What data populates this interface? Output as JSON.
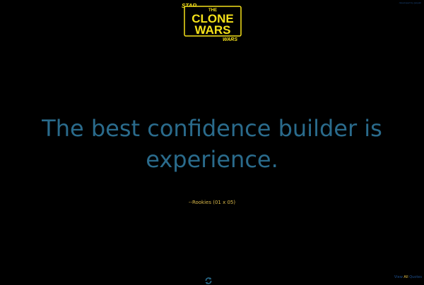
{
  "header": {
    "logo": {
      "top_text": "STAR",
      "the_text": "THE",
      "line1": "CLONE",
      "line2": "WARS",
      "bottom_text": "WARS"
    },
    "top_link": "developed by Jaqueli"
  },
  "quote": {
    "text": "The best confidence builder is experience.",
    "attribution": "--Rookies (01 x 05)"
  },
  "footer": {
    "refresh_icon": "refresh-icon",
    "view_all": {
      "view": "View",
      "all": "All",
      "quotes": "Quotes"
    }
  },
  "colors": {
    "background": "#000000",
    "quote": "#2a6b8c",
    "attribution": "#d9b84a",
    "logo_yellow": "#f5e11a",
    "link": "#1e4f8c"
  }
}
